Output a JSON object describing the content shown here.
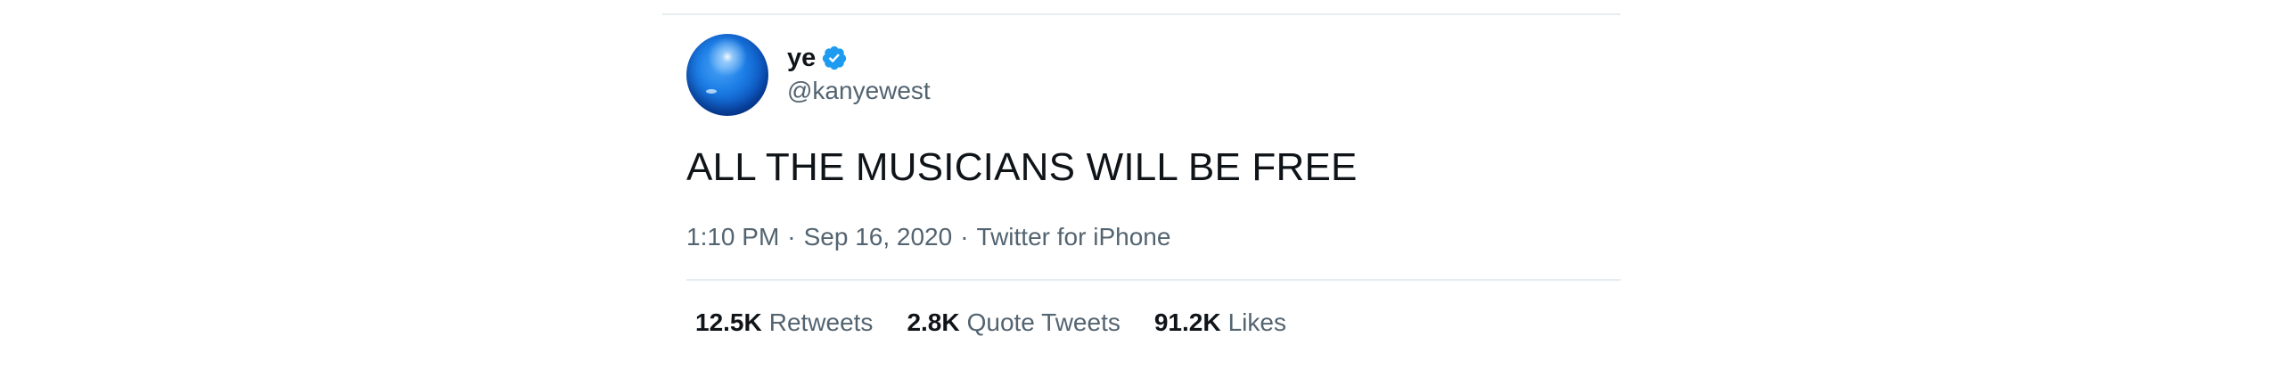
{
  "user": {
    "display_name": "ye",
    "handle": "@kanyewest",
    "verified": true,
    "avatar": "blue-sphere-avatar"
  },
  "tweet": {
    "text": "ALL THE MUSICIANS WILL BE FREE",
    "time": "1:10 PM",
    "date": "Sep 16, 2020",
    "source": "Twitter for iPhone",
    "separator": "·"
  },
  "stats": {
    "retweets": {
      "count": "12.5K",
      "label": "Retweets"
    },
    "quotes": {
      "count": "2.8K",
      "label": "Quote Tweets"
    },
    "likes": {
      "count": "91.2K",
      "label": "Likes"
    }
  },
  "colors": {
    "text_primary": "#0f1419",
    "text_secondary": "#536471",
    "verified_blue": "#1d9bf0",
    "divider": "#e6ecf0"
  }
}
